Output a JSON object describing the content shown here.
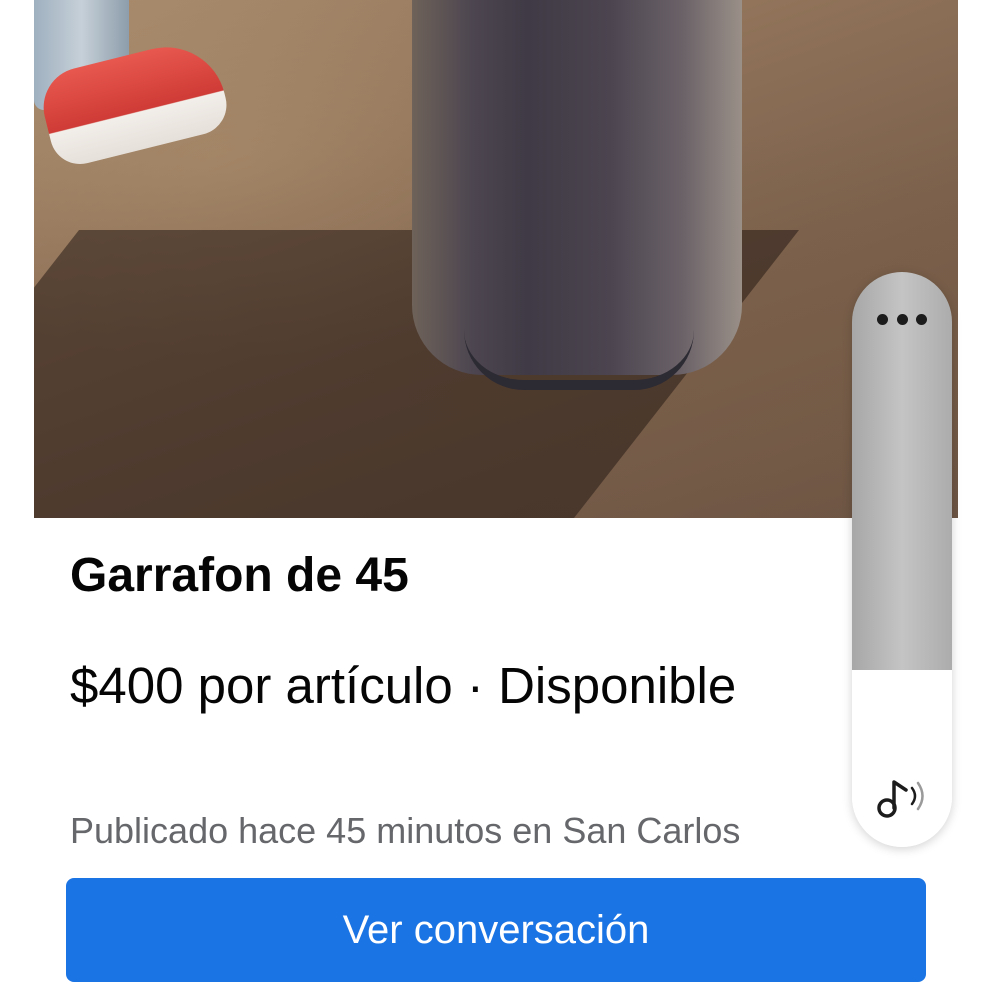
{
  "listing": {
    "title": "Garrafon de 45",
    "price_line": "$400 por artículo · Disponible",
    "posted_info": "Publicado hace 45 minutos en San Carlos"
  },
  "actions": {
    "view_conversation_label": "Ver conversación"
  },
  "edge_panel": {
    "icons": [
      "more-icon",
      "music-note-icon"
    ]
  },
  "colors": {
    "button_bg": "#1b74e4",
    "button_text": "#ffffff",
    "title_text": "#050505",
    "secondary_text": "#65676b"
  }
}
